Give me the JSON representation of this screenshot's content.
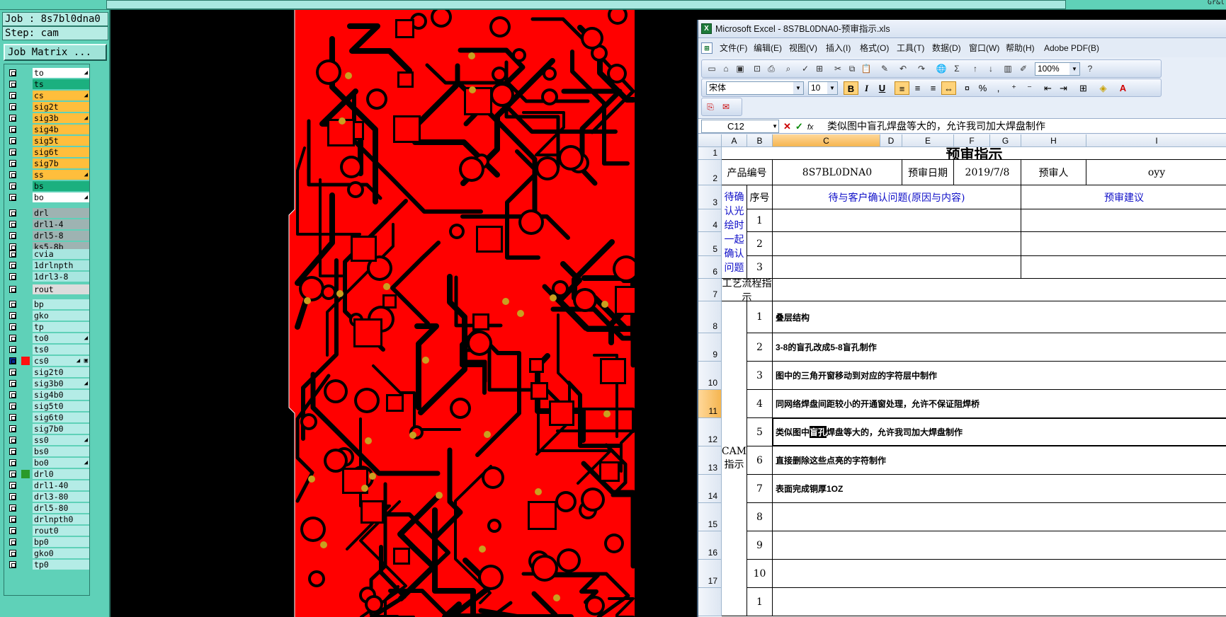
{
  "top_right_mark": "Gr&l",
  "left_panel": {
    "job_label": "Job : 8s7bl0dna0",
    "step_label": "Step: cam",
    "job_matrix_button": "Job Matrix ..."
  },
  "layers": [
    {
      "name": "to",
      "color": "#ffffff",
      "flag": "◢"
    },
    {
      "name": "ts",
      "color": "#1bb07f",
      "flag": ""
    },
    {
      "name": "cs",
      "color": "#ffbe3c",
      "flag": "◢"
    },
    {
      "name": "sig2t",
      "color": "#ffbe3c",
      "flag": ""
    },
    {
      "name": "sig3b",
      "color": "#ffbe3c",
      "flag": "◢"
    },
    {
      "name": "sig4b",
      "color": "#ffbe3c",
      "flag": ""
    },
    {
      "name": "sig5t",
      "color": "#ffbe3c",
      "flag": ""
    },
    {
      "name": "sig6t",
      "color": "#ffbe3c",
      "flag": ""
    },
    {
      "name": "sig7b",
      "color": "#ffbe3c",
      "flag": ""
    },
    {
      "name": "ss",
      "color": "#ffbe3c",
      "flag": "◢"
    },
    {
      "name": "bs",
      "color": "#1bb07f",
      "flag": ""
    },
    {
      "name": "bo",
      "color": "#ffffff",
      "flag": "◢"
    },
    {
      "name": "drl",
      "color": "#9eb3b2",
      "flag": ""
    },
    {
      "name": "drl1-4",
      "color": "#9eb3b2",
      "flag": ""
    },
    {
      "name": "drl5-8",
      "color": "#9eb3b2",
      "flag": ""
    },
    {
      "name": "ks5-8b",
      "color": "#9eb3b2",
      "flag": ""
    },
    {
      "name": "cvia",
      "color": "#a8e6e0",
      "flag": ""
    },
    {
      "name": "1drlnpth",
      "color": "#a8e6e0",
      "flag": ""
    },
    {
      "name": "1drl3-8",
      "color": "#a8e6e0",
      "flag": ""
    },
    {
      "name": "rout",
      "color": "#dcdcdc",
      "flag": ""
    },
    {
      "name": "bp",
      "color": "#b4ece6",
      "flag": ""
    },
    {
      "name": "gko",
      "color": "#b4ece6",
      "flag": ""
    },
    {
      "name": "tp",
      "color": "#b4ece6",
      "flag": ""
    },
    {
      "name": "to0",
      "color": "#b4ece6",
      "flag": "◢"
    },
    {
      "name": "ts0",
      "color": "#b4ece6",
      "flag": ""
    },
    {
      "name": "cs0",
      "color": "#b4ece6",
      "flag": "◢ ▣",
      "checked": true,
      "marker": "red"
    },
    {
      "name": "sig2t0",
      "color": "#b4ece6",
      "flag": ""
    },
    {
      "name": "sig3b0",
      "color": "#b4ece6",
      "flag": "◢"
    },
    {
      "name": "sig4b0",
      "color": "#b4ece6",
      "flag": ""
    },
    {
      "name": "sig5t0",
      "color": "#b4ece6",
      "flag": ""
    },
    {
      "name": "sig6t0",
      "color": "#b4ece6",
      "flag": ""
    },
    {
      "name": "sig7b0",
      "color": "#b4ece6",
      "flag": ""
    },
    {
      "name": "ss0",
      "color": "#b4ece6",
      "flag": "◢"
    },
    {
      "name": "bs0",
      "color": "#b4ece6",
      "flag": ""
    },
    {
      "name": "bo0",
      "color": "#b4ece6",
      "flag": "◢"
    },
    {
      "name": "drl0",
      "color": "#b4ece6",
      "flag": "",
      "marker": "green"
    },
    {
      "name": "drl1-40",
      "color": "#b4ece6",
      "flag": ""
    },
    {
      "name": "drl3-80",
      "color": "#b4ece6",
      "flag": ""
    },
    {
      "name": "drl5-80",
      "color": "#b4ece6",
      "flag": ""
    },
    {
      "name": "drlnpth0",
      "color": "#b4ece6",
      "flag": ""
    },
    {
      "name": "rout0",
      "color": "#b4ece6",
      "flag": ""
    },
    {
      "name": "bp0",
      "color": "#b4ece6",
      "flag": ""
    },
    {
      "name": "gko0",
      "color": "#b4ece6",
      "flag": ""
    },
    {
      "name": "tp0",
      "color": "#b4ece6",
      "flag": ""
    }
  ],
  "pcb": {
    "trace_color": "#ff0000",
    "via_color": "#c8a020",
    "background": "#000000"
  },
  "excel": {
    "window_title": "Microsoft Excel - 8S7BL0DNA0-预审指示.xls",
    "menu": [
      "文件(F)",
      "编辑(E)",
      "视图(V)",
      "插入(I)",
      "格式(O)",
      "工具(T)",
      "数据(D)",
      "窗口(W)",
      "帮助(H)",
      "Adobe PDF(B)"
    ],
    "zoom": "100%",
    "font_name": "宋体",
    "font_size": "10",
    "bold_label": "B",
    "italic_label": "I",
    "underline_label": "U",
    "name_box": "C12",
    "formula": "类似图中盲孔焊盘等大的，允许我司加大焊盘制作",
    "columns": [
      "A",
      "B",
      "C",
      "D",
      "E",
      "F",
      "G",
      "H",
      "I"
    ],
    "rows": [
      "1",
      "2",
      "3",
      "4",
      "5",
      "6",
      "7",
      "8",
      "9",
      "10",
      "11",
      "12",
      "13",
      "14",
      "15",
      "16",
      "17"
    ],
    "sheet": {
      "title": "预审指示",
      "product_label": "产品编号",
      "product_value": "8S7BL0DNA0",
      "date_label": "预审日期",
      "date_value": "2019/7/8",
      "reviewer_label": "预审人",
      "reviewer_value": "oyy",
      "side_label": "待确认光绘时一起确认问题",
      "seq_label": "序号",
      "issue_header": "待与客户确认问题(原因与内容)",
      "suggest_header": "预审建议",
      "q_nums": [
        "1",
        "2",
        "3"
      ],
      "process_label": "工艺流程指示",
      "cam_label": "CAM指示",
      "cam_items": [
        {
          "no": "1",
          "text": "叠层结构"
        },
        {
          "no": "2",
          "text": "3-8的盲孔改成5-8盲孔制作"
        },
        {
          "no": "3",
          "text": "图中的三角开窗移动到对应的字符层中制作"
        },
        {
          "no": "4",
          "text": "同网络焊盘间距较小的开通窗处理，允许不保证阻焊桥"
        },
        {
          "no": "5",
          "text": "类似图中盲孔焊盘等大的，允许我司加大焊盘制作"
        },
        {
          "no": "6",
          "text": "直接删除这些点亮的字符制作"
        },
        {
          "no": "7",
          "text": "表面完成铜厚1OZ"
        },
        {
          "no": "8",
          "text": ""
        },
        {
          "no": "9",
          "text": ""
        },
        {
          "no": "10",
          "text": ""
        },
        {
          "no": "1",
          "text": ""
        }
      ],
      "highlight_pre": "类似图中",
      "highlight": "盲孔",
      "highlight_post": "焊盘等大的，允许我司加大焊盘制作"
    }
  }
}
